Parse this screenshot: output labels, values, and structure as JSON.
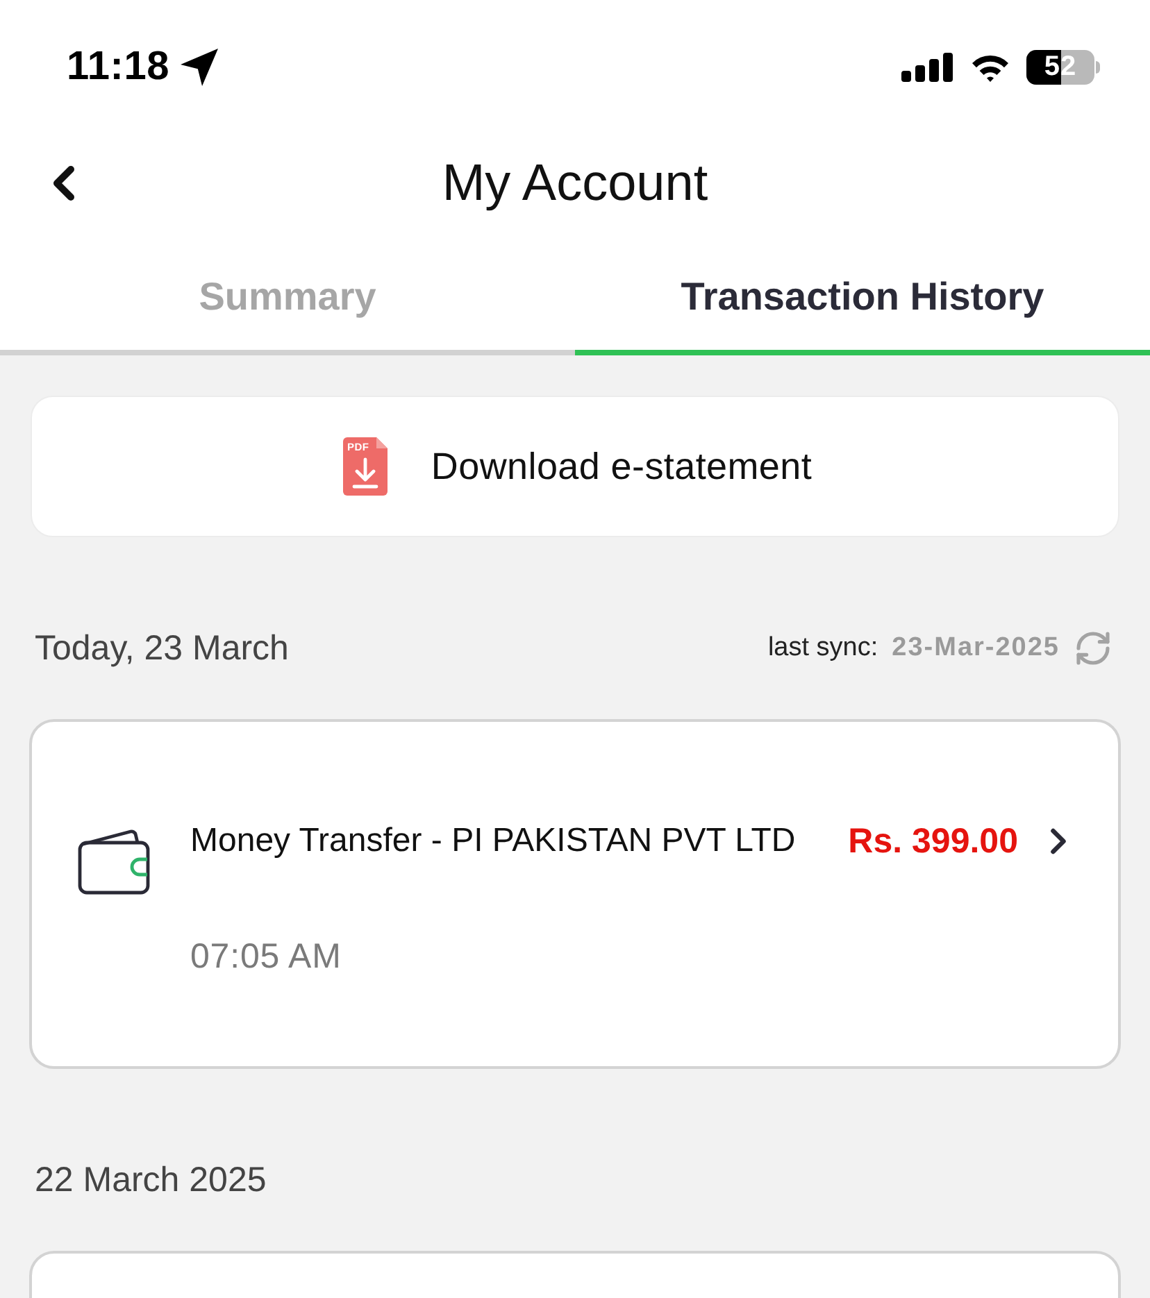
{
  "status_bar": {
    "time": "11:18",
    "battery": "52"
  },
  "header": {
    "title": "My Account"
  },
  "tabs": [
    {
      "label": "Summary",
      "selected": false
    },
    {
      "label": "Transaction History",
      "selected": true
    }
  ],
  "download_button": {
    "icon_text": "PDF",
    "label": "Download e-statement"
  },
  "sections": [
    {
      "date": "Today, 23 March",
      "sync": {
        "label": "last sync:",
        "value": "23-Mar-2025"
      },
      "transactions": [
        {
          "title": "Money Transfer - PI PAKISTAN PVT LTD",
          "amount": "Rs. 399.00",
          "kind": "debit",
          "time": "07:05 AM"
        }
      ]
    },
    {
      "date": "22 March 2025",
      "partial_card": true
    }
  ]
}
